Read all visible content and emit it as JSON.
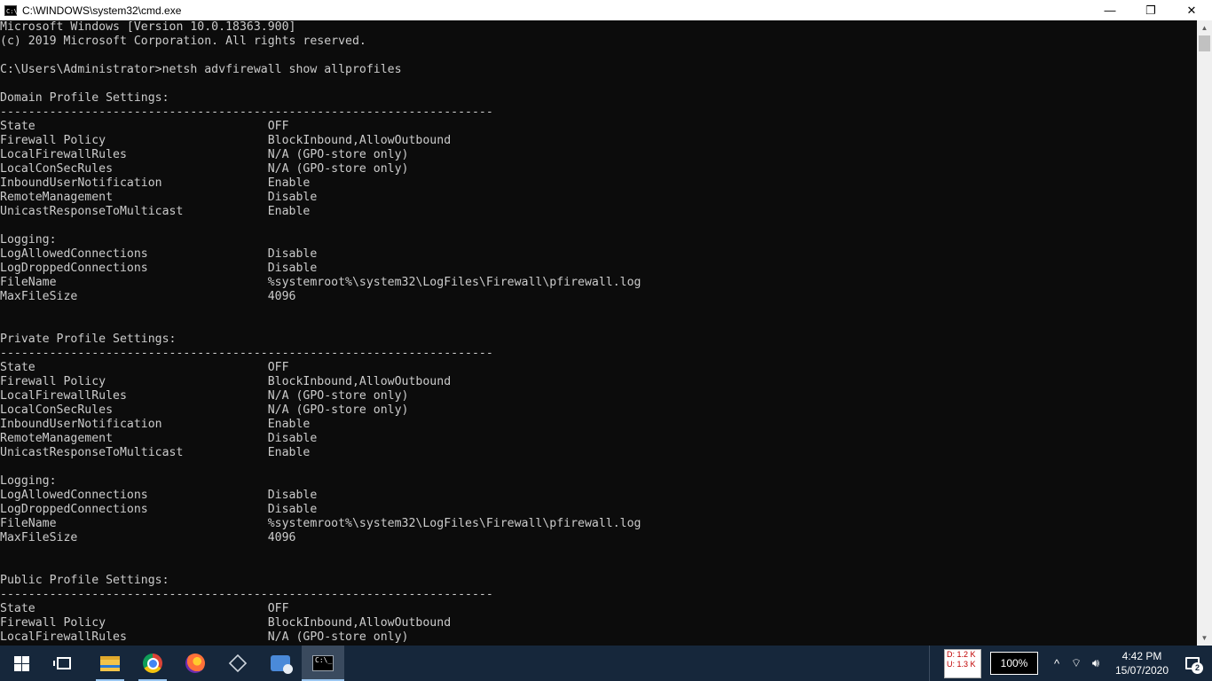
{
  "window": {
    "title": "C:\\WINDOWS\\system32\\cmd.exe",
    "icon": "cmd-icon",
    "minimize": "—",
    "maximize": "❐",
    "close": "✕"
  },
  "console": {
    "lines": [
      "Microsoft Windows [Version 10.0.18363.900]",
      "(c) 2019 Microsoft Corporation. All rights reserved.",
      "",
      "C:\\Users\\Administrator>netsh advfirewall show allprofiles",
      "",
      "Domain Profile Settings:",
      "----------------------------------------------------------------------",
      "State                                 OFF",
      "Firewall Policy                       BlockInbound,AllowOutbound",
      "LocalFirewallRules                    N/A (GPO-store only)",
      "LocalConSecRules                      N/A (GPO-store only)",
      "InboundUserNotification               Enable",
      "RemoteManagement                      Disable",
      "UnicastResponseToMulticast            Enable",
      "",
      "Logging:",
      "LogAllowedConnections                 Disable",
      "LogDroppedConnections                 Disable",
      "FileName                              %systemroot%\\system32\\LogFiles\\Firewall\\pfirewall.log",
      "MaxFileSize                           4096",
      "",
      "",
      "Private Profile Settings:",
      "----------------------------------------------------------------------",
      "State                                 OFF",
      "Firewall Policy                       BlockInbound,AllowOutbound",
      "LocalFirewallRules                    N/A (GPO-store only)",
      "LocalConSecRules                      N/A (GPO-store only)",
      "InboundUserNotification               Enable",
      "RemoteManagement                      Disable",
      "UnicastResponseToMulticast            Enable",
      "",
      "Logging:",
      "LogAllowedConnections                 Disable",
      "LogDroppedConnections                 Disable",
      "FileName                              %systemroot%\\system32\\LogFiles\\Firewall\\pfirewall.log",
      "MaxFileSize                           4096",
      "",
      "",
      "Public Profile Settings:",
      "----------------------------------------------------------------------",
      "State                                 OFF",
      "Firewall Policy                       BlockInbound,AllowOutbound",
      "LocalFirewallRules                    N/A (GPO-store only)"
    ],
    "text_color": "#cccccc",
    "background": "#0c0c0c"
  },
  "scrollbar": {
    "up_arrow": "▲",
    "down_arrow": "▼"
  },
  "taskbar": {
    "background": "#16273b",
    "apps": [
      {
        "name": "start",
        "icon": "windows-start-icon"
      },
      {
        "name": "task-view",
        "icon": "task-view-icon"
      },
      {
        "name": "file-explorer",
        "icon": "folder-icon"
      },
      {
        "name": "chrome",
        "icon": "chrome-icon"
      },
      {
        "name": "firefox",
        "icon": "firefox-icon"
      },
      {
        "name": "virtualbox",
        "icon": "cube-icon"
      },
      {
        "name": "thunderbird",
        "icon": "mail-icon"
      },
      {
        "name": "cmd",
        "icon": "cmd-icon",
        "active": true
      }
    ],
    "cmd_icon_text": "C:\\_",
    "net_meter": {
      "download": "D: 1.2 K",
      "upload": "U: 1.3 K"
    },
    "zoom": "100%",
    "tray_icons": {
      "chevron": "^",
      "network": "⌔",
      "volume": "🔊︎"
    },
    "clock": {
      "time": "4:42 PM",
      "date": "15/07/2020"
    },
    "notifications": {
      "count": "2"
    }
  }
}
